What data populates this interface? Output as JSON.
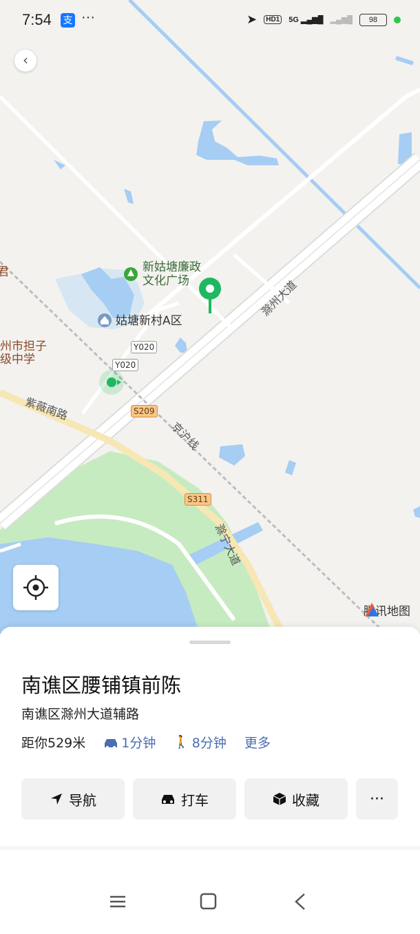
{
  "status": {
    "time": "7:54",
    "alipay": "支",
    "more": "···",
    "hd": "HD1",
    "net": "5G",
    "battery": "98"
  },
  "map": {
    "poi_park": "新姑塘廉政\n文化广场",
    "poi_village": "姑塘新村A区",
    "poi_school": "州市担子\n级中学",
    "edge_char": "君",
    "road_chuzhou": "滁州大道",
    "road_ziwei": "紫薇南路",
    "road_jinghu": "京沪线",
    "road_chuning": "滁宁大道",
    "shield_y020_a": "Y020",
    "shield_y020_b": "Y020",
    "shield_s209": "S209",
    "shield_s311": "S311",
    "logo_text": "腾讯地图",
    "colors": {
      "water": "#a6cdf3",
      "green": "#c7ebc0",
      "road": "#ffffff",
      "pin": "#1fb860"
    }
  },
  "place": {
    "title": "南谯区腰铺镇前陈",
    "address": "南谯区滁州大道辅路",
    "distance": "距你529米",
    "drive_time": "1分钟",
    "walk_time": "8分钟",
    "more": "更多"
  },
  "actions": {
    "navigate": "导航",
    "taxi": "打车",
    "favorite": "收藏",
    "more": "···"
  }
}
